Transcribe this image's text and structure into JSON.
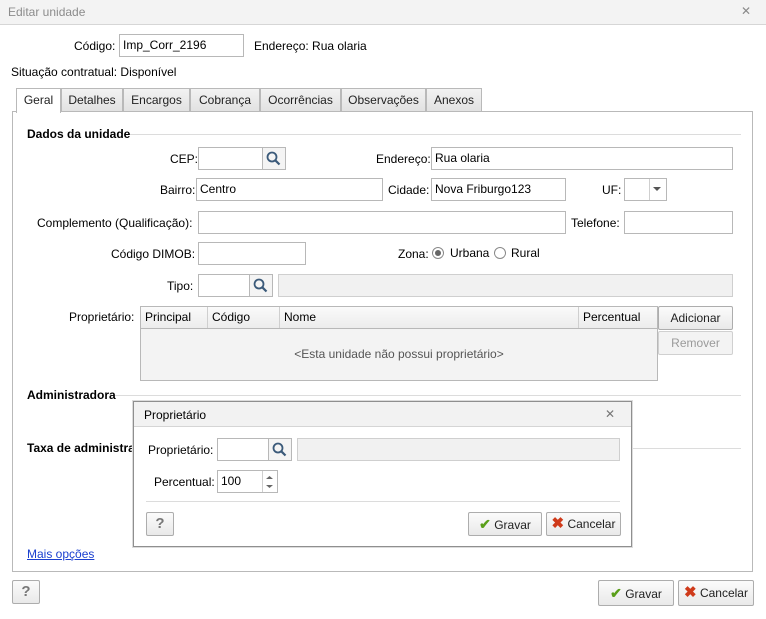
{
  "window": {
    "title": "Editar unidade",
    "close_glyph": "✕"
  },
  "header": {
    "codigo_label": "Código:",
    "codigo_value": "Imp_Corr_2196",
    "endereco_text": "Endereço: Rua olaria",
    "situacao_text": "Situação contratual: Disponível"
  },
  "tabs": [
    {
      "label": "Geral"
    },
    {
      "label": "Detalhes"
    },
    {
      "label": "Encargos"
    },
    {
      "label": "Cobrança"
    },
    {
      "label": "Ocorrências"
    },
    {
      "label": "Observações"
    },
    {
      "label": "Anexos"
    }
  ],
  "dados": {
    "section_title": "Dados da unidade",
    "cep_label": "CEP:",
    "cep_value": "",
    "endereco_label": "Endereço:",
    "endereco_value": "Rua olaria",
    "bairro_label": "Bairro:",
    "bairro_value": "Centro",
    "cidade_label": "Cidade:",
    "cidade_value": "Nova Friburgo123",
    "uf_label": "UF:",
    "uf_value": "",
    "complemento_label": "Complemento (Qualificação):",
    "complemento_value": "",
    "telefone_label": "Telefone:",
    "telefone_value": "",
    "dimob_label": "Código DIMOB:",
    "dimob_value": "",
    "zona_label": "Zona:",
    "zona_options": [
      "Urbana",
      "Rural"
    ],
    "zona_selected": "Urbana",
    "tipo_label": "Tipo:",
    "tipo_value": "",
    "tipo_desc": ""
  },
  "proprietario": {
    "label": "Proprietário:",
    "columns": [
      "Principal",
      "Código",
      "Nome",
      "Percentual"
    ],
    "empty_text": "<Esta unidade não possui proprietário>",
    "add_label": "Adicionar",
    "remove_label": "Remover"
  },
  "administradora": {
    "section_title": "Administradora"
  },
  "taxa": {
    "section_title": "Taxa de administração"
  },
  "mais_opcoes": "Mais opções",
  "footer": {
    "help_label": "?",
    "gravar_label": "Gravar",
    "cancelar_label": "Cancelar"
  },
  "dialog": {
    "title": "Proprietário",
    "close_glyph": "✕",
    "proprietario_label": "Proprietário:",
    "proprietario_value": "",
    "proprietario_desc": "",
    "percentual_label": "Percentual:",
    "percentual_value": "100",
    "help_label": "?",
    "gravar_label": "Gravar",
    "cancelar_label": "Cancelar"
  },
  "colors": {
    "link": "#1a3fcf",
    "check": "#5a9f1a",
    "cancel": "#cf3a1a"
  }
}
